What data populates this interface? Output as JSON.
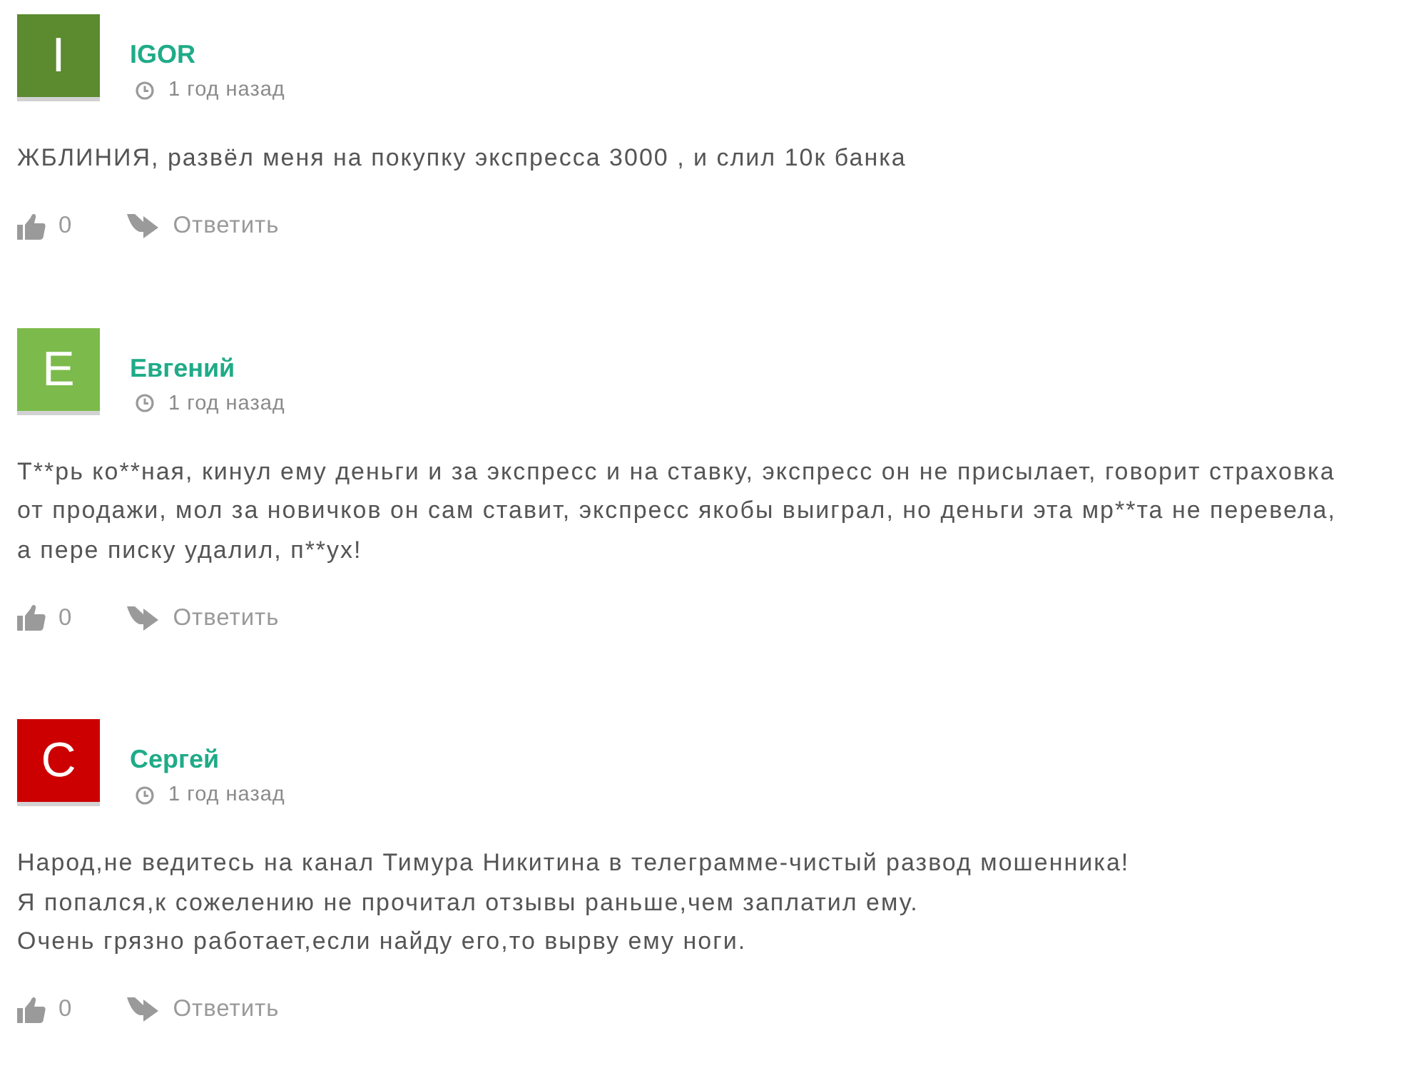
{
  "comments": [
    {
      "author": "IGOR",
      "avatar": {
        "letter": "I",
        "color": "#5b8a2f"
      },
      "time": "1 год назад",
      "body": [
        "ЖБЛИНИЯ, развёл меня на покупку экспресса 3000 , и слил 10к банка"
      ],
      "likes": "0",
      "reply": "Ответить"
    },
    {
      "author": "Евгений",
      "avatar": {
        "letter": "E",
        "color": "#7cbb4b"
      },
      "time": "1 год назад",
      "body": [
        "Т**рь ко**ная, кинул ему деньги и за экспресс и на ставку, экспресс он не присылает, говорит страховка",
        "от продажи, мол за новичков он сам ставит, экспресс якобы выиграл, но деньги эта мр**та не перевела,",
        "а пере писку удалил, п**ух!"
      ],
      "likes": "0",
      "reply": "Ответить"
    },
    {
      "author": "Сергей",
      "avatar": {
        "letter": "C",
        "color": "#cc0000"
      },
      "time": "1 год назад",
      "body": [
        "Народ,не ведитесь на канал Тимура Никитина в телеграмме-чистый развод мошенника!",
        "Я попался,к сожелению не прочитал отзывы раньше,чем заплатил ему.",
        "Очень грязно работает,если найду его,то вырву ему ноги."
      ],
      "likes": "0",
      "reply": "Ответить"
    }
  ]
}
